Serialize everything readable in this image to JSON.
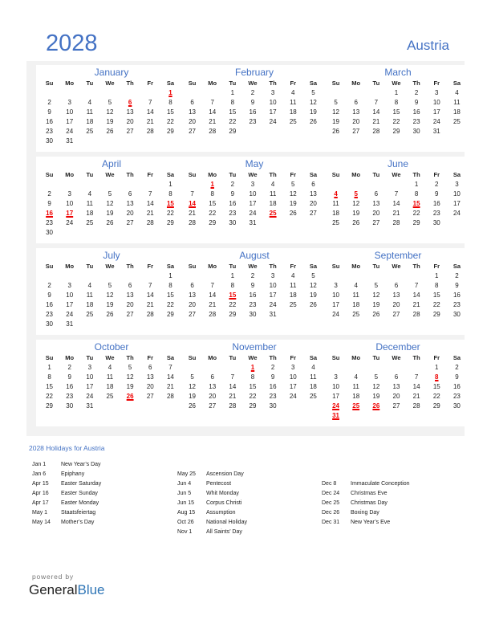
{
  "header": {
    "year": "2028",
    "country": "Austria"
  },
  "weekdays": [
    "Su",
    "Mo",
    "Tu",
    "We",
    "Th",
    "Fr",
    "Sa"
  ],
  "months": [
    {
      "name": "January",
      "start": 6,
      "days": 31,
      "holidays": [
        1,
        6
      ]
    },
    {
      "name": "February",
      "start": 2,
      "days": 29,
      "holidays": []
    },
    {
      "name": "March",
      "start": 3,
      "days": 31,
      "holidays": []
    },
    {
      "name": "April",
      "start": 6,
      "days": 30,
      "holidays": [
        15,
        16,
        17
      ]
    },
    {
      "name": "May",
      "start": 1,
      "days": 31,
      "holidays": [
        1,
        14,
        25
      ]
    },
    {
      "name": "June",
      "start": 4,
      "days": 30,
      "holidays": [
        4,
        5,
        15
      ]
    },
    {
      "name": "July",
      "start": 6,
      "days": 31,
      "holidays": []
    },
    {
      "name": "August",
      "start": 2,
      "days": 31,
      "holidays": [
        15
      ]
    },
    {
      "name": "September",
      "start": 5,
      "days": 30,
      "holidays": []
    },
    {
      "name": "October",
      "start": 0,
      "days": 31,
      "holidays": [
        26
      ]
    },
    {
      "name": "November",
      "start": 3,
      "days": 30,
      "holidays": [
        1
      ]
    },
    {
      "name": "December",
      "start": 5,
      "days": 31,
      "holidays": [
        8,
        24,
        25,
        26,
        31
      ]
    }
  ],
  "holidays_title": "2028 Holidays for Austria",
  "holiday_columns": [
    [
      {
        "date": "Jan 1",
        "name": "New Year’s Day"
      },
      {
        "date": "Jan 6",
        "name": "Epiphany"
      },
      {
        "date": "Apr 15",
        "name": "Easter Saturday"
      },
      {
        "date": "Apr 16",
        "name": "Easter Sunday"
      },
      {
        "date": "Apr 17",
        "name": "Easter Monday"
      },
      {
        "date": "May 1",
        "name": "Staatsfeiertag"
      },
      {
        "date": "May 14",
        "name": "Mother’s Day"
      }
    ],
    [
      {
        "date": "May 25",
        "name": "Ascension Day"
      },
      {
        "date": "Jun 4",
        "name": "Pentecost"
      },
      {
        "date": "Jun 5",
        "name": "Whit Monday"
      },
      {
        "date": "Jun 15",
        "name": "Corpus Christi"
      },
      {
        "date": "Aug 15",
        "name": "Assumption"
      },
      {
        "date": "Oct 26",
        "name": "National Holiday"
      },
      {
        "date": "Nov 1",
        "name": "All Saints’ Day"
      }
    ],
    [
      {
        "date": "Dec 8",
        "name": "Immaculate Conception"
      },
      {
        "date": "Dec 24",
        "name": "Christmas Eve"
      },
      {
        "date": "Dec 25",
        "name": "Christmas Day"
      },
      {
        "date": "Dec 26",
        "name": "Boxing Day"
      },
      {
        "date": "Dec 31",
        "name": "New Year’s Eve"
      }
    ]
  ],
  "footer": {
    "powered": "powered by",
    "brand_general": "General",
    "brand_blue": "Blue"
  }
}
